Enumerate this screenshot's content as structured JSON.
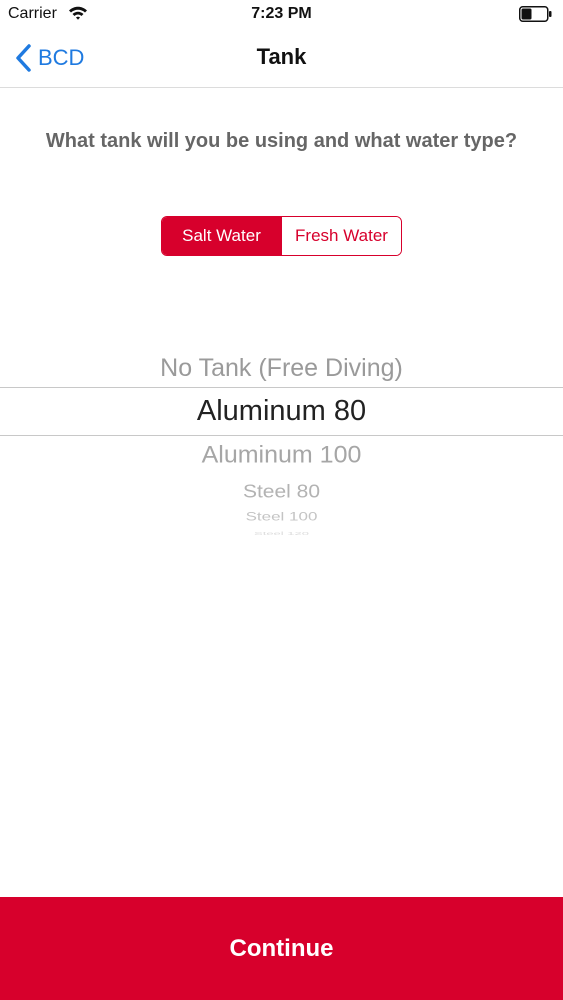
{
  "status_bar": {
    "carrier": "Carrier",
    "time": "7:23 PM",
    "battery_level": 0.4
  },
  "nav": {
    "back_label": "BCD",
    "title": "Tank"
  },
  "question": "What tank will you be using and what water type?",
  "water_type": {
    "options": [
      "Salt Water",
      "Fresh Water"
    ],
    "selected": "Salt Water"
  },
  "tank_picker": {
    "items": [
      "No Tank (Free Diving)",
      "Aluminum 80",
      "Aluminum 100",
      "Steel 80",
      "Steel 100",
      "Steel 120"
    ],
    "selected": "Aluminum 80"
  },
  "continue_label": "Continue",
  "colors": {
    "accent": "#d7002c",
    "link": "#1f7ae0"
  },
  "icons": [
    "wifi-icon",
    "battery-icon",
    "chevron-left-icon"
  ]
}
